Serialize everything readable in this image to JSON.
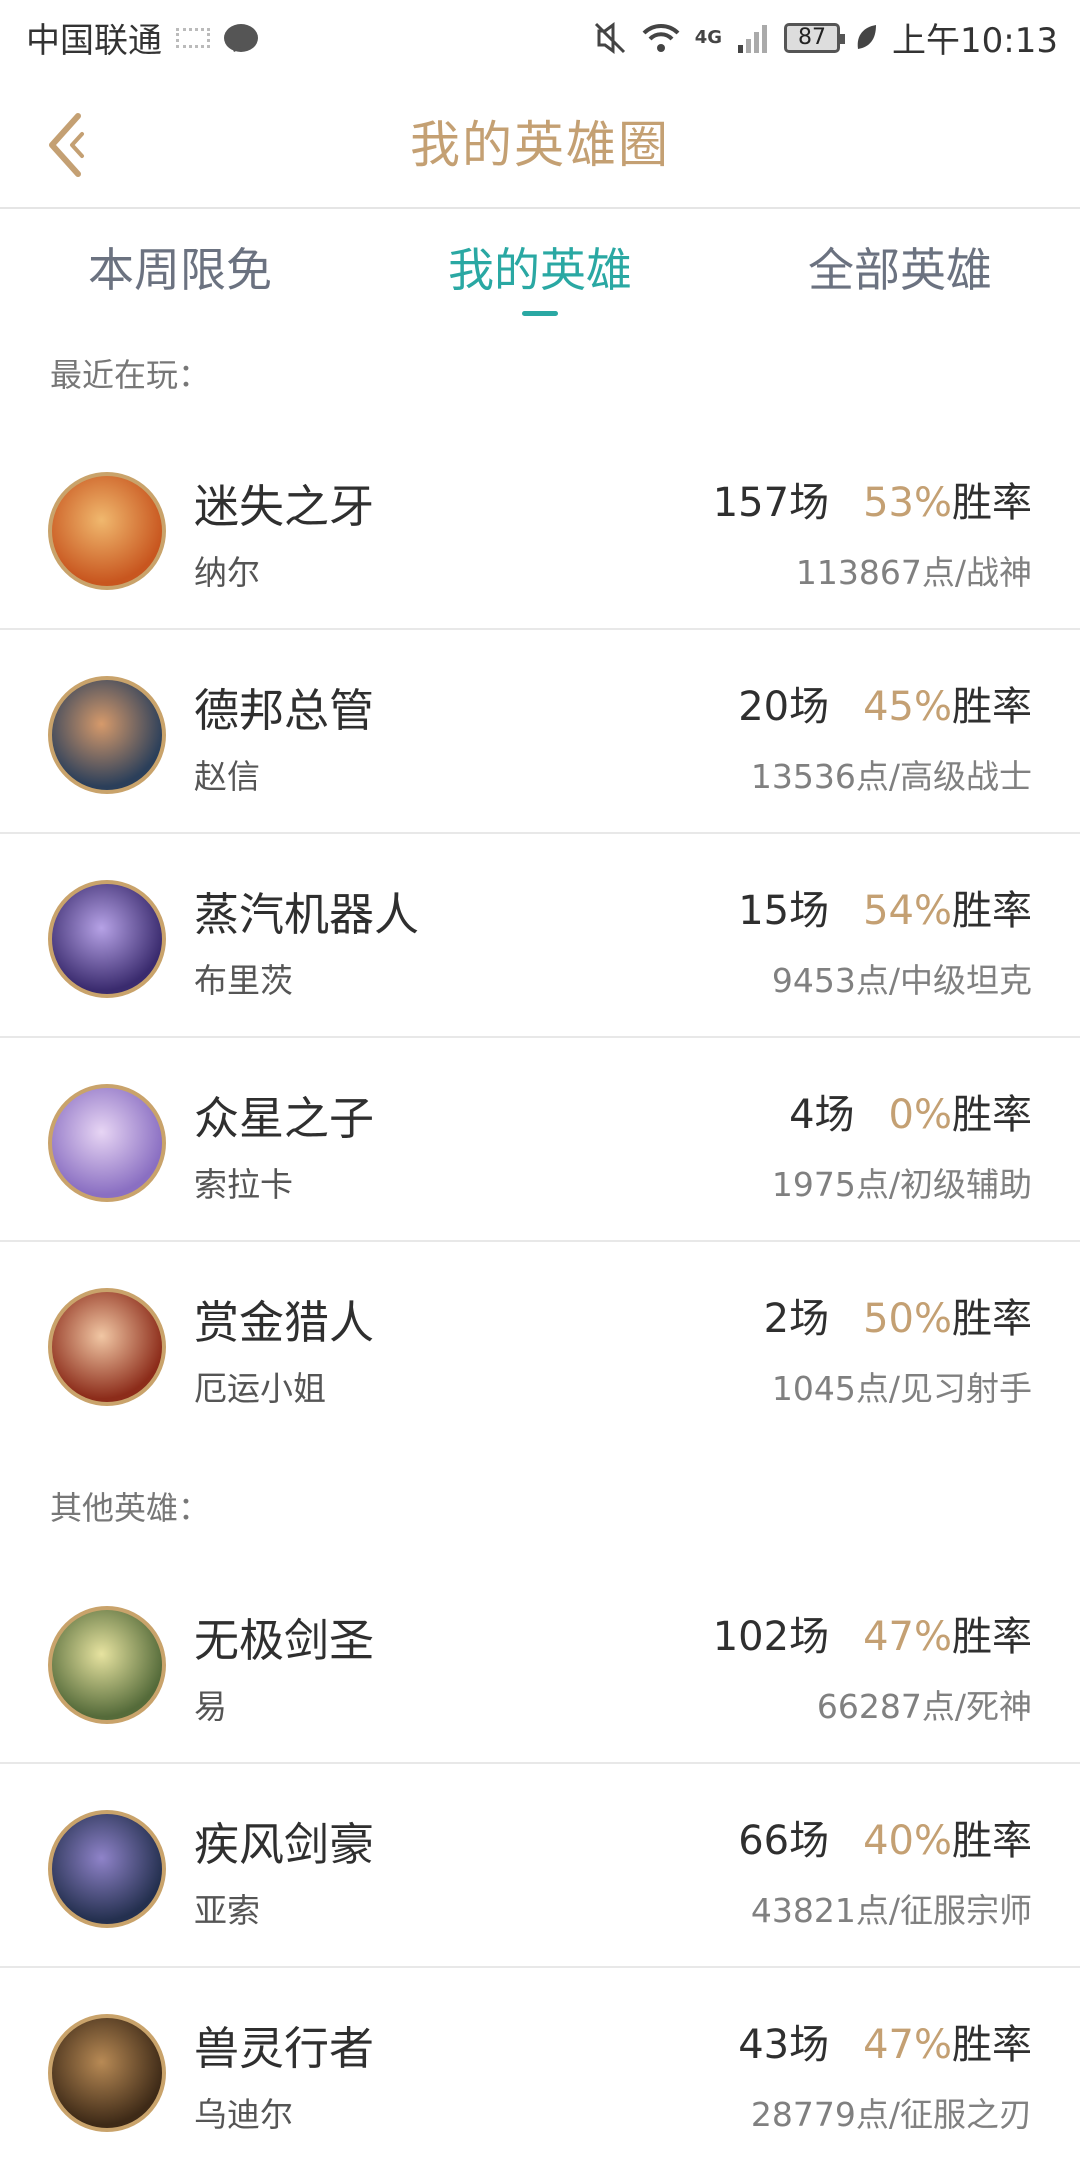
{
  "status_bar": {
    "carrier": "中国联通",
    "battery": "87",
    "time": "上午10:13",
    "network": "4G"
  },
  "header": {
    "title": "我的英雄圈"
  },
  "tabs": [
    {
      "label": "本周限免"
    },
    {
      "label": "我的英雄"
    },
    {
      "label": "全部英雄"
    }
  ],
  "sections": {
    "recent_label": "最近在玩：",
    "other_label": "其他英雄："
  },
  "recent_heroes": [
    {
      "name": "迷失之牙",
      "sub": "纳尔",
      "games": "157场",
      "winrate": "53%",
      "winrate_suffix": "胜率",
      "points": "113867点/战神",
      "colors": [
        "#c8561f",
        "#f0b86e"
      ]
    },
    {
      "name": "德邦总管",
      "sub": "赵信",
      "games": "20场",
      "winrate": "45%",
      "winrate_suffix": "胜率",
      "points": "13536点/高级战士",
      "colors": [
        "#2b3f5a",
        "#d69a6b"
      ]
    },
    {
      "name": "蒸汽机器人",
      "sub": "布里茨",
      "games": "15场",
      "winrate": "54%",
      "winrate_suffix": "胜率",
      "points": "9453点/中级坦克",
      "colors": [
        "#3a2b6e",
        "#b6a2e6"
      ]
    },
    {
      "name": "众星之子",
      "sub": "索拉卡",
      "games": "4场",
      "winrate": "0%",
      "winrate_suffix": "胜率",
      "points": "1975点/初级辅助",
      "colors": [
        "#8a6fc2",
        "#e7d5f4"
      ]
    },
    {
      "name": "赏金猎人",
      "sub": "厄运小姐",
      "games": "2场",
      "winrate": "50%",
      "winrate_suffix": "胜率",
      "points": "1045点/见习射手",
      "colors": [
        "#8c2c1a",
        "#f1c7a4"
      ]
    }
  ],
  "other_heroes": [
    {
      "name": "无极剑圣",
      "sub": "易",
      "games": "102场",
      "winrate": "47%",
      "winrate_suffix": "胜率",
      "points": "66287点/死神",
      "colors": [
        "#556b3a",
        "#e7e3a0"
      ]
    },
    {
      "name": "疾风剑豪",
      "sub": "亚索",
      "games": "66场",
      "winrate": "40%",
      "winrate_suffix": "胜率",
      "points": "43821点/征服宗师",
      "colors": [
        "#24304f",
        "#8f83c9"
      ]
    },
    {
      "name": "兽灵行者",
      "sub": "乌迪尔",
      "games": "43场",
      "winrate": "47%",
      "winrate_suffix": "胜率",
      "points": "28779点/征服之刃",
      "colors": [
        "#3e2a17",
        "#b88a55"
      ]
    }
  ]
}
